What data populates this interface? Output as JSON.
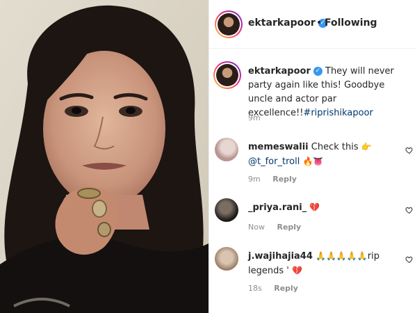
{
  "post": {
    "username": "ektarkapoor",
    "follow_separator": "•",
    "follow_status": "Following",
    "verified_mark": "✓"
  },
  "caption": {
    "username": "ektarkapoor",
    "text": "They will never party again like this! Goodbye uncle and actor par excellence!!",
    "hashtag": "#riprishikapoor",
    "time": "9m"
  },
  "comments": [
    {
      "username": "memeswalii",
      "text": "Check this",
      "emoji_after_text": "👉",
      "mention": "@t_for_troll",
      "emoji_after_mention": "🔥👅",
      "time": "9m",
      "reply_label": "Reply",
      "avatar_colors": [
        "#e8d6d2",
        "#b89690"
      ]
    },
    {
      "username": "_priya.rani_",
      "text": "",
      "emoji_after_text": "💔",
      "time": "Now",
      "reply_label": "Reply",
      "avatar_colors": [
        "#5a5046",
        "#1e1a18"
      ]
    },
    {
      "username": "j.wajihajia44",
      "text": "",
      "emoji_after_username": "🙏🙏🙏🙏🙏",
      "text_after_emoji": "rip legends '",
      "emoji_after_text": "💔",
      "time": "18s",
      "reply_label": "Reply",
      "avatar_colors": [
        "#d8c4b0",
        "#9a7a62"
      ]
    }
  ],
  "icons": {
    "like": "heart-outline-icon",
    "verified": "verified-badge-icon"
  },
  "colors": {
    "link": "#00376b",
    "verified": "#3897f0",
    "muted": "#8e8e8e",
    "text": "#262626"
  }
}
